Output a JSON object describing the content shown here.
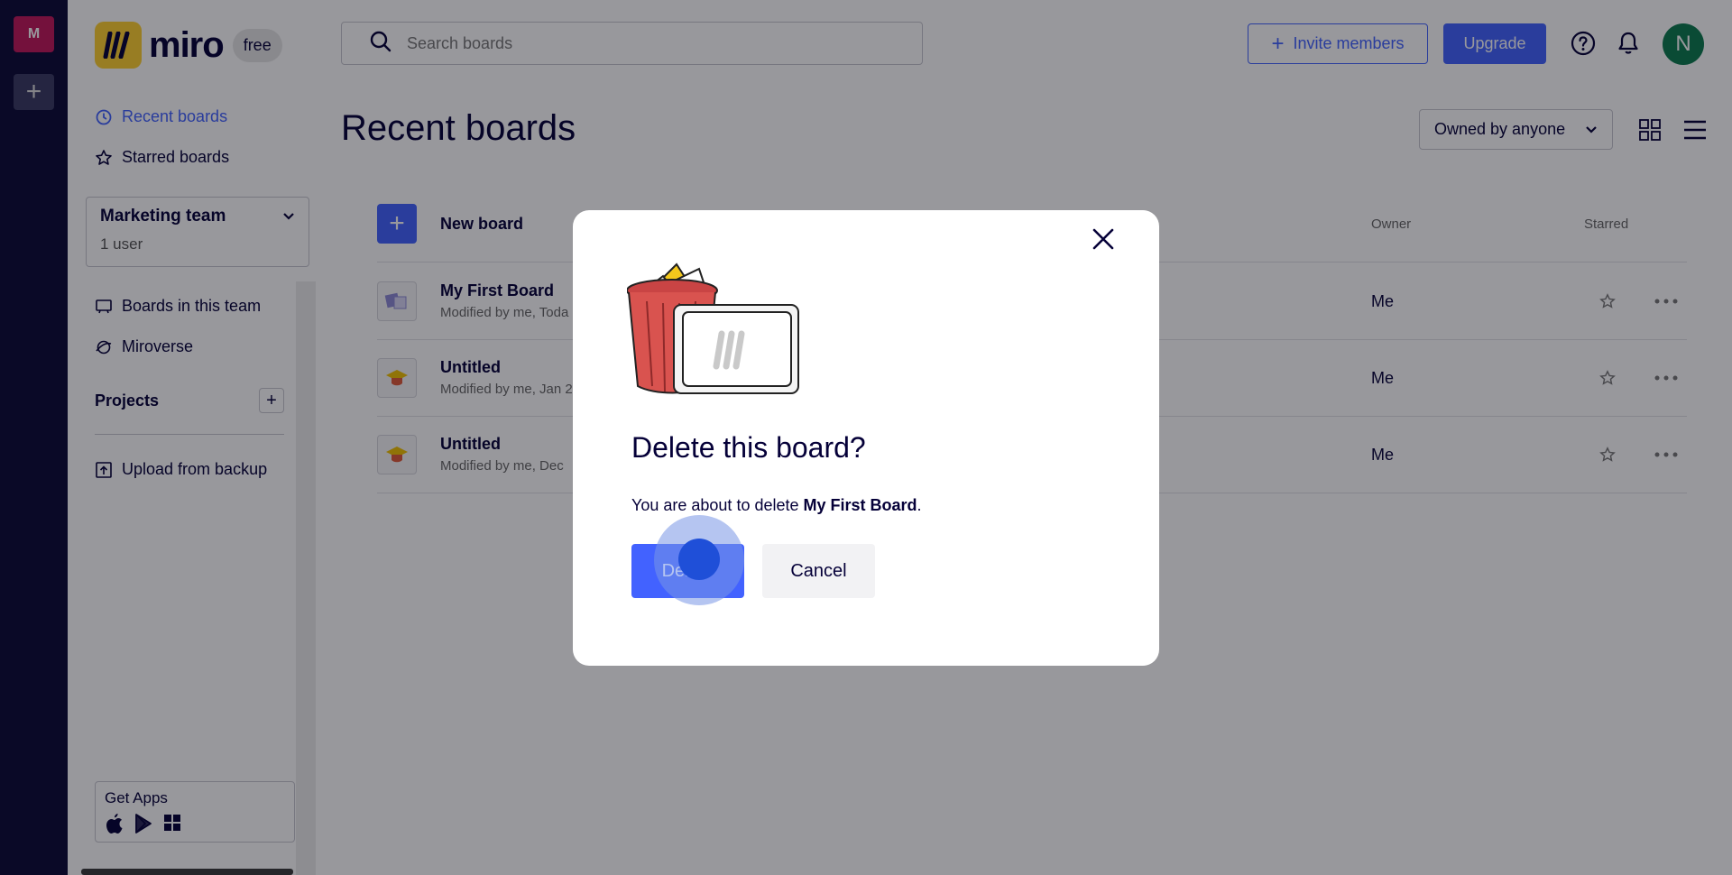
{
  "rail": {
    "team_initial": "M",
    "add_symbol": "+"
  },
  "brand": {
    "name": "miro",
    "plan": "free"
  },
  "sidebar": {
    "nav": [
      {
        "label": "Recent boards",
        "icon": "clock-icon",
        "active": true
      },
      {
        "label": "Starred boards",
        "icon": "star-icon",
        "active": false
      }
    ],
    "team": {
      "name": "Marketing team",
      "users": "1 user"
    },
    "team_links": [
      {
        "label": "Boards in this team",
        "icon": "board-icon"
      },
      {
        "label": "Miroverse",
        "icon": "miroverse-icon"
      }
    ],
    "projects": {
      "title": "Projects",
      "add_symbol": "+"
    },
    "upload_label": "Upload from backup",
    "get_apps": {
      "label": "Get Apps",
      "icons": [
        "apple-icon",
        "google-play-icon",
        "windows-icon"
      ]
    }
  },
  "header": {
    "search_placeholder": "Search boards",
    "invite_label": "Invite members",
    "upgrade_label": "Upgrade",
    "avatar_initial": "N"
  },
  "main": {
    "title": "Recent boards",
    "owner_filter": "Owned by anyone",
    "new_board_label": "New board",
    "columns": {
      "owner": "Owner",
      "starred": "Starred"
    },
    "boards": [
      {
        "name": "My First Board",
        "modified": "Modified by me, Toda",
        "owner": "Me",
        "thumb": "sticky-notes-thumb"
      },
      {
        "name": "Untitled",
        "modified": "Modified by me, Jan 2",
        "owner": "Me",
        "thumb": "graduation-cap-thumb"
      },
      {
        "name": "Untitled",
        "modified": "Modified by me, Dec",
        "owner": "Me",
        "thumb": "graduation-cap-thumb"
      }
    ]
  },
  "dialog": {
    "title": "Delete this board?",
    "text_prefix": "You are about to delete ",
    "board_name": "My First Board",
    "text_suffix": ".",
    "delete_label": "Delete",
    "cancel_label": "Cancel"
  },
  "colors": {
    "accent": "#4262ff",
    "rail": "#0b0a36",
    "brand_yellow": "#ffd02f",
    "avatar": "#0c7a4e",
    "team_badge": "#c2185b"
  }
}
